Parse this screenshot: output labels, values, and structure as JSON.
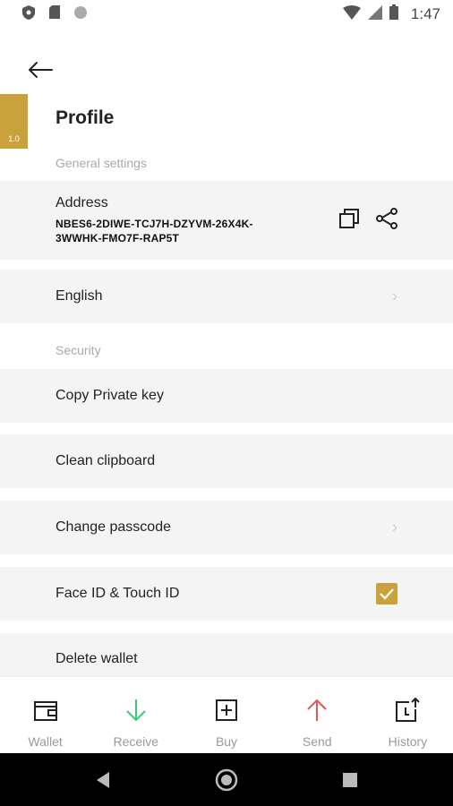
{
  "status_bar": {
    "time": "1:47",
    "icons": [
      "shield-icon",
      "sim-card-icon",
      "circle-icon",
      "wifi-icon",
      "signal-icon",
      "battery-icon"
    ]
  },
  "header": {
    "back_icon": "arrow-left-icon",
    "title": "Profile",
    "version": "1.0"
  },
  "sections": {
    "general_label": "General settings",
    "security_label": "Security"
  },
  "address": {
    "title": "Address",
    "value": "NBES6-2DIWE-TCJ7H-DZYVM-26X4K-3WWHK-FMO7F-RAP5T",
    "copy_icon": "copy-icon",
    "share_icon": "share-icon"
  },
  "settings": {
    "language": "English",
    "copy_private_key": "Copy Private key",
    "clean_clipboard": "Clean clipboard",
    "change_passcode": "Change passcode",
    "face_id": "Face ID & Touch ID",
    "face_id_enabled": true,
    "delete_wallet": "Delete wallet"
  },
  "bottom_nav": {
    "items": [
      {
        "label": "Wallet",
        "icon": "wallet-icon"
      },
      {
        "label": "Receive",
        "icon": "arrow-down-icon"
      },
      {
        "label": "Buy",
        "icon": "plus-box-icon"
      },
      {
        "label": "Send",
        "icon": "arrow-up-icon"
      },
      {
        "label": "History",
        "icon": "history-icon"
      }
    ]
  },
  "colors": {
    "accent": "#c9a23c",
    "receive": "#3cc97a",
    "send": "#e0555a",
    "row_bg": "#f4f4f4"
  }
}
